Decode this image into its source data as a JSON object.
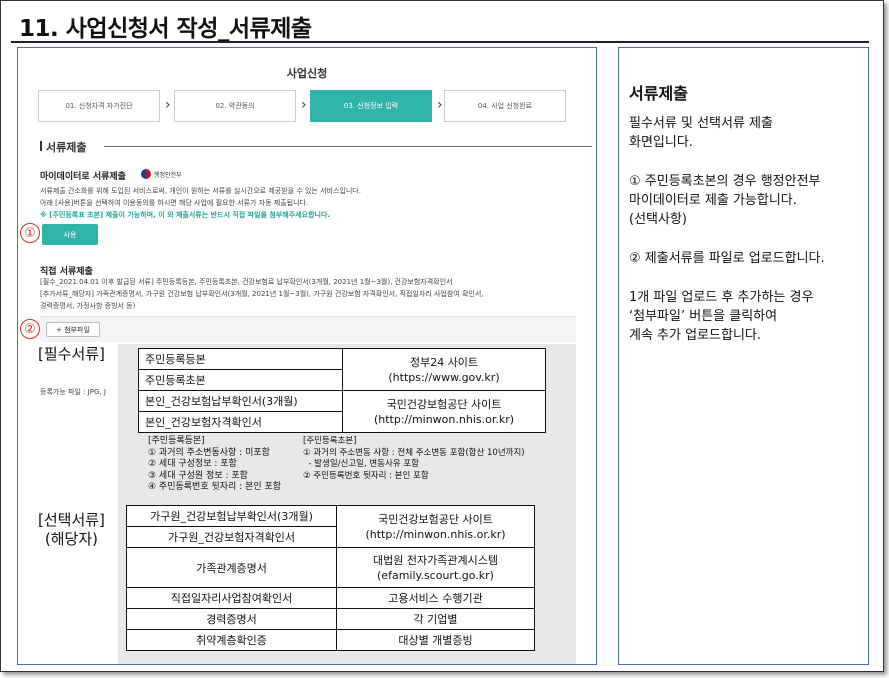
{
  "page_title": "11. 사업신청서 작성_서류제출",
  "apply": {
    "title": "사업신청",
    "steps": [
      "01. 신청자격 자가진단",
      "02. 약관동의",
      "03. 신청정보 입력",
      "04. 사업 신청완료"
    ],
    "active_step": 3
  },
  "section": {
    "title": "서류제출"
  },
  "mydata": {
    "title": "마이데이터로 서류제출",
    "gov_label": "행정안전부",
    "desc1": "서류제출 간소화를 위해 도입된 서비스로써, 개인이 원하는 서류를 실시간으로 제공받을 수 있는 서비스입니다.",
    "desc2": "아래 [사용]버튼을 선택하여 이용동의를 하시면 해당 사업에 필요한 서류가 자동 제출됩니다.",
    "desc3": "※ [주민등록표 초본] 제출이 가능하며, 이 외 제출서류는 반드시 직접 파일을 첨부해주세요합니다.",
    "use_button": "사용",
    "marker": "①"
  },
  "direct": {
    "title": "직접 서류제출",
    "line1": "[필수_2021.04.01 이후 발급된 서류] 주민등록등본, 주민등록초본, 건강보험료 납부확인서(3개월, 2021년 1월~3월), 건강보험자격확인서",
    "line2": "[추가서류_해당자] 가족관계증명서, 가구원 건강보험 납부확인서(3개월, 2021년 1월~3월), 가구원 건강보험 자격확인서, 직접일자리 사업참여 확인서,",
    "line3": "경력증명서, 가정사항 증빙서 등)",
    "attach_button": "+ 첨부파일",
    "marker": "②",
    "upload_note": "등록가능 파일 : JPG, J"
  },
  "required": {
    "label": "[필수서류]",
    "docs": [
      "주민등록등본",
      "주민등록초본",
      "본인_건강보험납부확인서(3개월)",
      "본인_건강보험자격확인서"
    ],
    "sources": [
      {
        "name": "정부24 사이트",
        "url": "(https://www.gov.kr)"
      },
      {
        "name": "국민건강보험공단 사이트",
        "url": "(http://minwon.nhis.or.kr)"
      }
    ],
    "notes_left": [
      "[주민등록등본]",
      "① 과거의 주소변동사항 : 미포함",
      "② 세대 구성정보 : 포함",
      "③ 세대 구성원 정보 : 포함",
      "④ 주민등록번호 뒷자리 : 본인 포함"
    ],
    "notes_right": [
      "[주민등록초본]",
      "① 과거의 주소변동 사항 : 전체 주소변동 포함(합산 10년까지)",
      "  - 발생일/신고일, 변동사유 포함",
      "② 주민등록번호 뒷자리 : 본인 포함"
    ]
  },
  "optional": {
    "label_line1": "[선택서류]",
    "label_line2": "(해당자)",
    "rows": [
      {
        "doc": "가구원_건강보험납부확인서(3개월)",
        "source": "국민건강보험공단 사이트"
      },
      {
        "doc": "가구원_건강보험자격확인서",
        "source": "(http://minwon.nhis.or.kr)"
      },
      {
        "doc": "가족관계증명서",
        "source": "대법원 전자가족관계시스템"
      },
      {
        "doc": "",
        "source": "(efamily.scourt.go.kr)"
      },
      {
        "doc": "직접일자리사업참여확인서",
        "source": "고용서비스 수행기관"
      },
      {
        "doc": "경력증명서",
        "source": "각 기업별"
      },
      {
        "doc": "취약계층확인증",
        "source": "대상별 개별증빙"
      }
    ]
  },
  "sidebar": {
    "title": "서류제출",
    "p1_line1": "필수서류 및 선택서류 제출",
    "p1_line2": "화면입니다.",
    "p2_line1": "① 주민등록초본의 경우 행정안전부",
    "p2_line2": "마이데이터로 제출 가능합니다.",
    "p2_line3": "(선택사항)",
    "p3_line1": "② 제출서류를 파일로 업로드합니다.",
    "p4_line1": "1개 파일 업로드 후 추가하는 경우",
    "p4_line2": "‘첨부파일’ 버튼을 클릭하여",
    "p4_line3": "계속 추가 업로드합니다."
  }
}
